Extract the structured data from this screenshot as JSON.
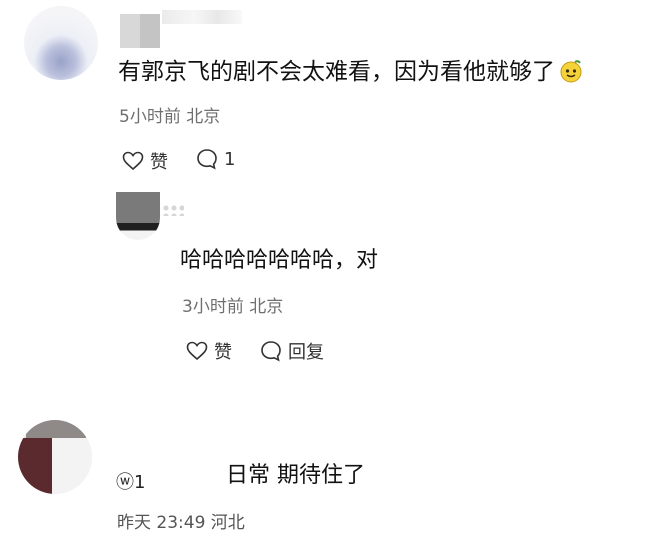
{
  "comments": [
    {
      "text": "有郭京飞的剧不会太难看，因为看他就够了",
      "meta": "5小时前 北京",
      "like_label": "赞",
      "reply_count": "1"
    }
  ],
  "reply": {
    "text": "哈哈哈哈哈哈哈，对",
    "meta": "3小时前 北京",
    "like_label": "赞",
    "reply_label": "回复"
  },
  "comment3": {
    "name_fragment": "ⓦ1",
    "text": "日常 期待住了",
    "meta": "昨天 23:49 河北"
  },
  "icons": {
    "heart": "heart-outline-icon",
    "comment": "comment-bubble-icon",
    "emoji": "smiley-sticker-icon"
  }
}
